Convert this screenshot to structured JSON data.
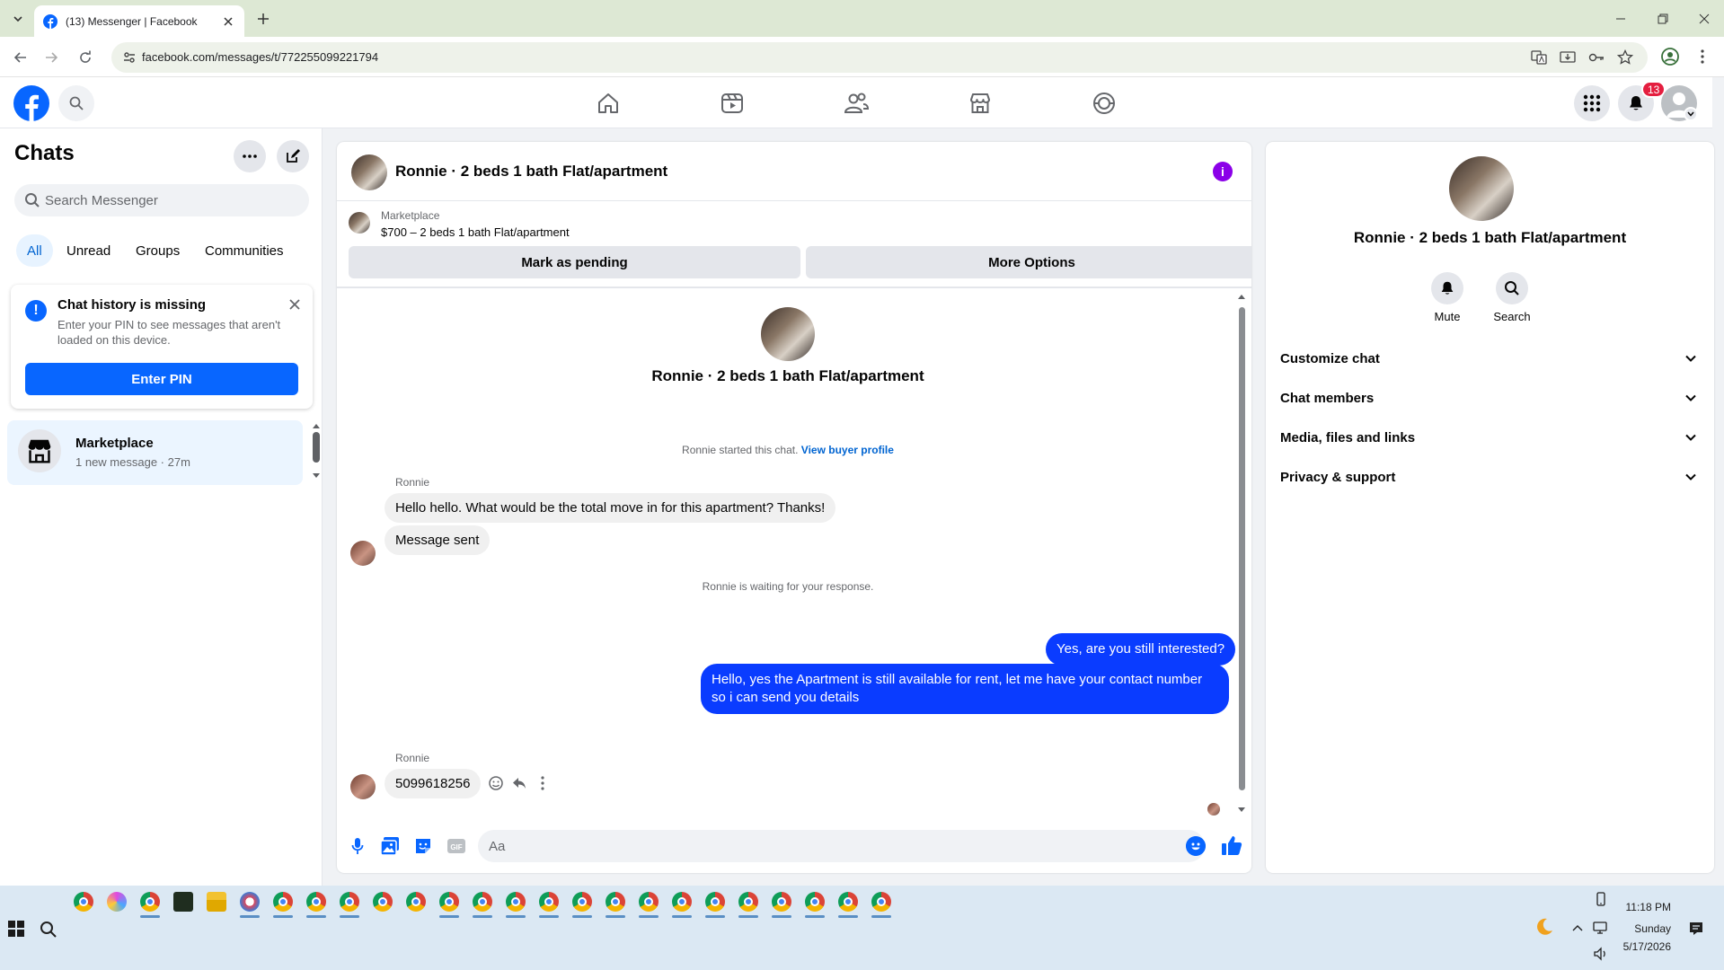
{
  "browser": {
    "tab_title": "(13) Messenger | Facebook",
    "url": "facebook.com/messages/t/772255099221794"
  },
  "fb": {
    "notification_count": "13"
  },
  "sidebar": {
    "title": "Chats",
    "search_placeholder": "Search Messenger",
    "filters": [
      "All",
      "Unread",
      "Groups",
      "Communities"
    ],
    "active_filter": "All",
    "pin_card": {
      "title": "Chat history is missing",
      "body": "Enter your PIN to see messages that aren't loaded on this device.",
      "button": "Enter PIN"
    },
    "chats": [
      {
        "name": "Marketplace",
        "subtitle": "1 new message · 27m"
      }
    ]
  },
  "conversation": {
    "title": "Ronnie · 2 beds 1 bath Flat/apartment",
    "marketplace_label": "Marketplace",
    "listing": "$700 – 2 beds 1 bath Flat/apartment",
    "mark_pending": "Mark as pending",
    "more_options": "More Options",
    "center_name": "Ronnie · 2 beds 1 bath Flat/apartment",
    "started_text": "Ronnie started this chat.",
    "view_buyer_profile": "View buyer profile",
    "waiting_text": "Ronnie is waiting for your response.",
    "messages": [
      {
        "sender": "Ronnie",
        "direction": "in",
        "text": "Hello hello. What would be the total move in for this apartment? Thanks!"
      },
      {
        "sender": "Ronnie",
        "direction": "in",
        "text": "Message sent"
      },
      {
        "sender": "me",
        "direction": "out",
        "text": "Yes, are you still interested?"
      },
      {
        "sender": "me",
        "direction": "out",
        "text": "Hello, yes the Apartment is still available for rent, let me have your contact number so i can send you details"
      },
      {
        "sender": "Ronnie",
        "direction": "in",
        "text": "5099618256"
      }
    ],
    "composer_placeholder": "Aa"
  },
  "info_panel": {
    "name": "Ronnie · 2 beds 1 bath Flat/apartment",
    "actions": [
      "Mute",
      "Search"
    ],
    "sections": [
      "Customize chat",
      "Chat members",
      "Media, files and links",
      "Privacy & support"
    ]
  },
  "taskbar": {
    "time": "11:18 PM",
    "day": "Sunday",
    "date": "5/17/2026"
  },
  "colors": {
    "fb_blue": "#0866ff",
    "messenger_bubble": "#0a3cff",
    "info_purple": "#8b00e8",
    "badge_red": "#e41e3f"
  }
}
